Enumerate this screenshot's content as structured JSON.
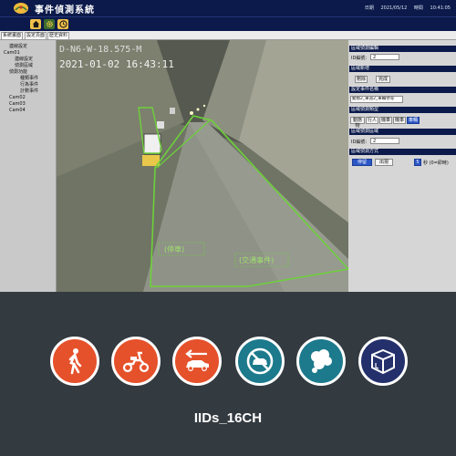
{
  "app": {
    "title": "事件偵測系統",
    "date_label": "日期",
    "date": "2021/05/12",
    "time_label": "時間",
    "time": "10:41:05"
  },
  "tabs": [
    "系統畫面",
    "設定頁面",
    "歷史資料"
  ],
  "tree": {
    "items": [
      {
        "label": "連線設定",
        "level": 1
      },
      {
        "label": "Cam01",
        "level": 0
      },
      {
        "label": "連線設定",
        "level": 2
      },
      {
        "label": "偵測區域",
        "level": 2
      },
      {
        "label": "偵測功能",
        "level": 1
      },
      {
        "label": "種類事件",
        "level": 3
      },
      {
        "label": "行為事件",
        "level": 3
      },
      {
        "label": "計數事件",
        "level": 3
      },
      {
        "label": "Cam02",
        "level": 0
      },
      {
        "label": "Cam03",
        "level": 0
      },
      {
        "label": "Cam04",
        "level": 0
      }
    ]
  },
  "video": {
    "osd_line1": "D-N6-W-18.575-M",
    "osd_line2": "2021-01-02 16:43:11",
    "zone_labels": [
      "(停車)",
      "(交通事件)"
    ]
  },
  "panel": {
    "zone_edit_header": "區域偵測編輯",
    "id_label": "ID編號:",
    "id_value": "2",
    "zone_add_header": "區域新增",
    "delete_btn": "刪除",
    "done_btn": "完成",
    "event_name_header": "設定事件名稱",
    "event_name_value": "動態2_車道2_車輛停等",
    "type_header": "區域偵測類型",
    "type_buttons": [
      "動態物",
      "行人",
      "機車",
      "機車",
      "車輛"
    ],
    "type_active_index": 4,
    "zone_id_header": "區域偵測區域",
    "zone_id_label": "ID編號:",
    "zone_id_value": "2",
    "mode_header": "區域偵測方式",
    "mode_buttons": [
      "停留",
      "出現"
    ],
    "mode_active_index": 0,
    "seconds_value": "5",
    "seconds_label": "秒 (0=即時)"
  },
  "features": [
    {
      "name": "pedestrian-icon",
      "color": "#e5512b"
    },
    {
      "name": "scooter-icon",
      "color": "#e5512b"
    },
    {
      "name": "wrong-way-car-icon",
      "color": "#e5512b"
    },
    {
      "name": "no-parking-car-icon",
      "color": "#1c7a8c"
    },
    {
      "name": "smoke-icon",
      "color": "#1c7a8c"
    },
    {
      "name": "abandoned-object-box-icon",
      "color": "#24306b"
    }
  ],
  "product_name": "IIDs_16CH"
}
